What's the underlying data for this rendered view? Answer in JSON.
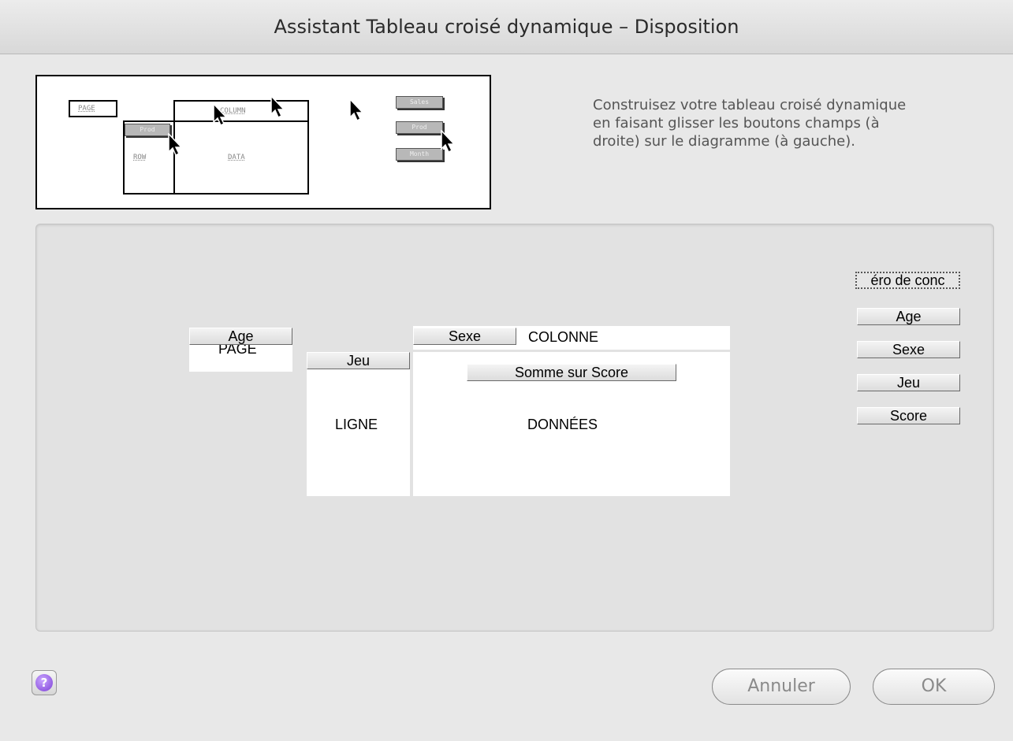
{
  "window": {
    "title": "Assistant Tableau croisé dynamique – Disposition"
  },
  "diagram": {
    "labels": {
      "page": "PAGE",
      "column": "COLUMN",
      "row": "ROW",
      "data": "DATA"
    },
    "buttons": {
      "prod_row": "Prod",
      "sales": "Sales",
      "prod": "Prod",
      "month": "Month"
    }
  },
  "instructions": "Construisez votre tableau croisé dynamique en faisant glisser les boutons champs (à droite) sur le diagramme (à gauche).",
  "layout": {
    "page_label": "PAGE",
    "column_label": "COLONNE",
    "row_label": "LIGNE",
    "data_label": "DONNÉES",
    "page_field": "Age",
    "column_field": "Sexe",
    "row_field": "Jeu",
    "data_field": "Somme sur Score"
  },
  "fields": [
    "éro de conc",
    "Age",
    "Sexe",
    "Jeu",
    "Score"
  ],
  "buttons": {
    "help": "?",
    "cancel": "Annuler",
    "ok": "OK"
  },
  "colors": {
    "help_accent": "#7d3fd6"
  }
}
